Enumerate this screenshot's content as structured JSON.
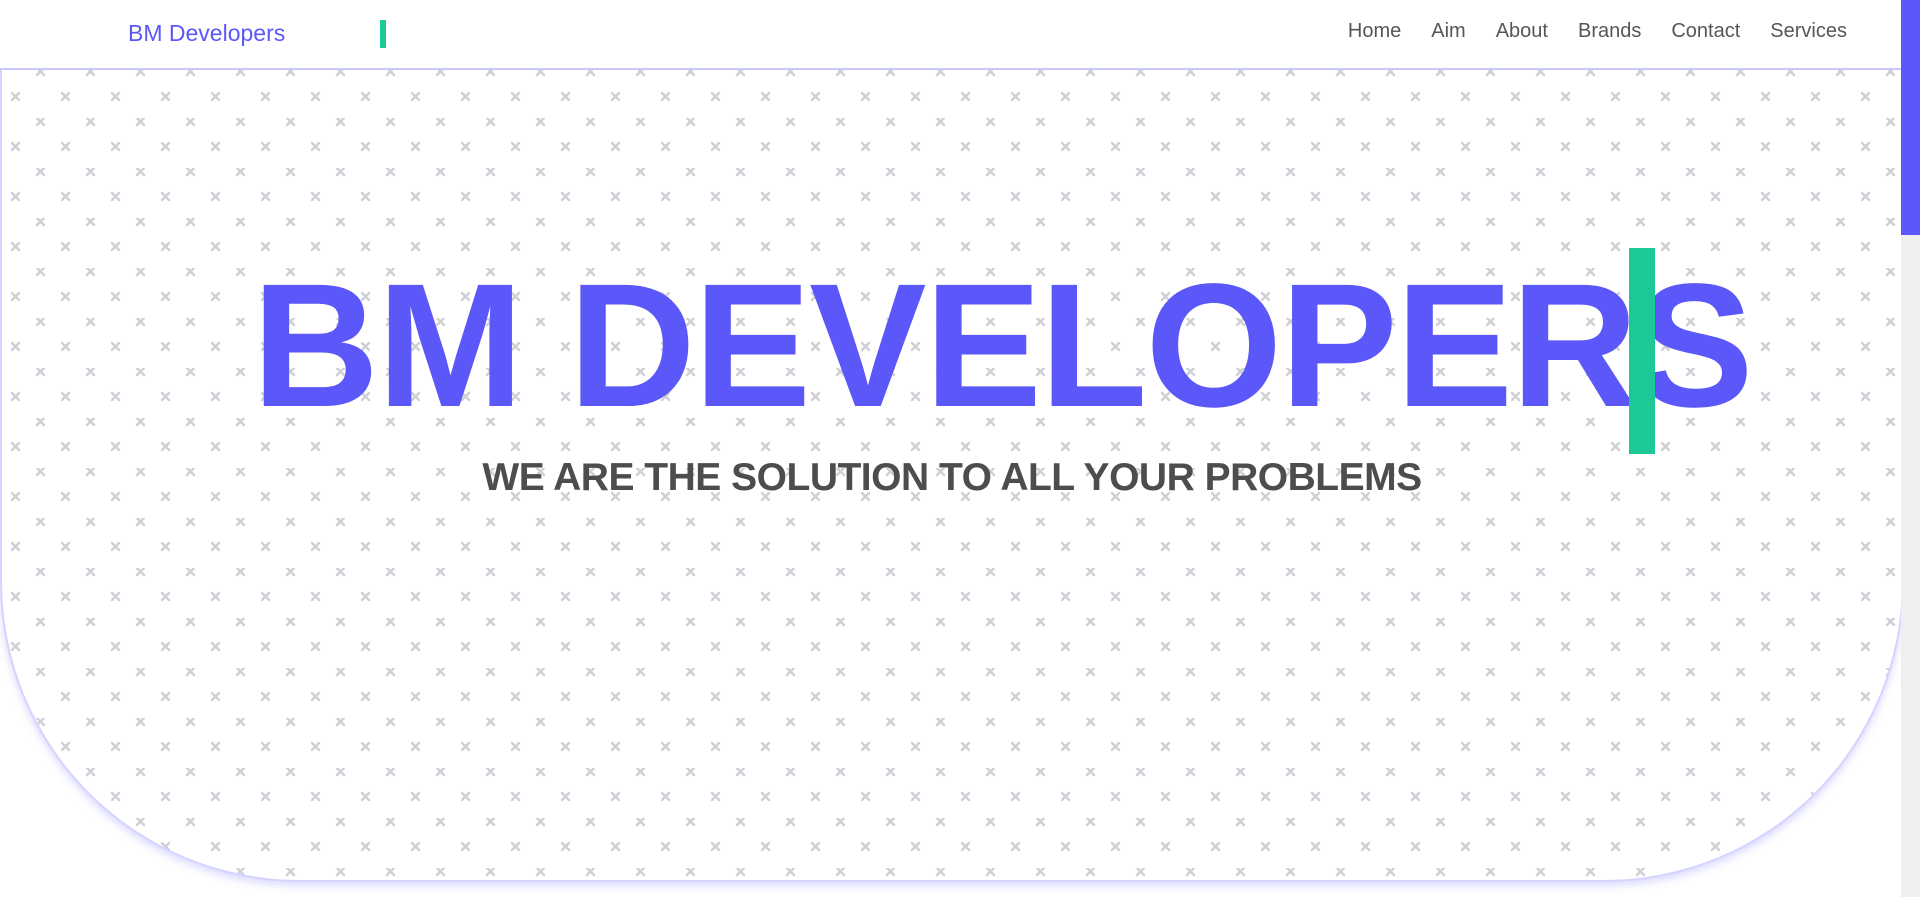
{
  "navbar": {
    "brand": "BM Developers",
    "links": [
      "Home",
      "Aim",
      "About",
      "Brands",
      "Contact",
      "Services"
    ]
  },
  "hero": {
    "title": "BM DEVELOPERS",
    "subtitle": "WE ARE THE SOLUTION TO ALL YOUR PROBLEMS"
  },
  "colors": {
    "accent": "#5b57f8",
    "cursor": "#1cc996",
    "text_dark": "#4d4d4d",
    "pattern": "#cfcfd6"
  }
}
